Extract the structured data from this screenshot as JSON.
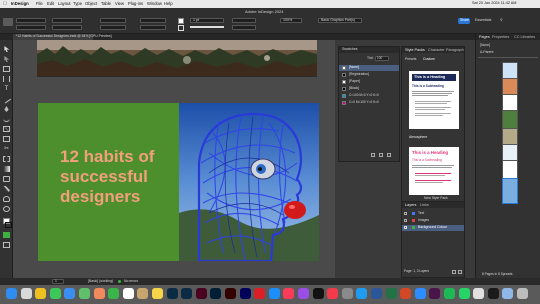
{
  "menubar": {
    "app": "InDesign",
    "items": [
      "File",
      "Edit",
      "Layout",
      "Type",
      "Object",
      "Table",
      "View",
      "Plug-ins",
      "Window",
      "Help"
    ],
    "title": "Adobe InDesign 2024",
    "clock": "Sat 20 Jan 2024 11:42 AM"
  },
  "controlbar": {
    "font_name": "Basic Graphics Part(s)",
    "share_label": "Share",
    "essentials_label": "Essentials",
    "stroke_value": "1 pt",
    "zoom_value": "100%"
  },
  "document": {
    "tab_label": "*12 Habits of Successful Designers.indd @ 54% [GPU Preview]"
  },
  "canvas": {
    "headline_line1": "12 habits of",
    "headline_line2": "successful",
    "headline_line3": "designers",
    "green": "#4c8f2c",
    "headline_color": "#f2a07c"
  },
  "swatches": {
    "title": "Swatches",
    "tint_label": "Tint:",
    "tint_value": "100",
    "items": [
      {
        "name": "[None]",
        "color": "#ffffff"
      },
      {
        "name": "[Registration]",
        "color": "#000000"
      },
      {
        "name": "[Paper]",
        "color": "#ffffff"
      },
      {
        "name": "[Black]",
        "color": "#000000"
      },
      {
        "name": "C=100 M=0 Y=0 K=0",
        "color": "#00a0e0"
      },
      {
        "name": "C=0 M=100 Y=0 K=0",
        "color": "#e0007a"
      }
    ]
  },
  "styles_panel": {
    "tabs": [
      "Style Packs",
      "Character",
      "Paragraph"
    ],
    "filters": [
      "Presets",
      "Custom"
    ],
    "preview1_heading": "This is a Heading",
    "preview1_subheading": "This is a Subheading",
    "section_label": "Atmosphere",
    "preview2_heading": "This is a Heading",
    "preview2_subheading": "This is a Subheading",
    "new_style_label": "New Style Pack"
  },
  "layers": {
    "tabs": [
      "Layers",
      "Links"
    ],
    "items": [
      {
        "name": "Text",
        "color": "#3c7bff"
      },
      {
        "name": "Images",
        "color": "#e04040"
      },
      {
        "name": "Background Colour",
        "color": "#3cb043"
      }
    ],
    "footer": "Page: 1, 3 Layers"
  },
  "pages": {
    "tabs": [
      "Pages",
      "Properties",
      "CC Libraries"
    ],
    "none_label": "[None]",
    "master_label": "A-Parent",
    "footer": "8 Pages in 8 Spreads"
  },
  "statusbar": {
    "page_value": "1",
    "style_label": "[Basic] (working)",
    "errors_label": "No errors"
  },
  "dock": {
    "apps": [
      {
        "name": "finder-icon",
        "color": "#2f8cf0"
      },
      {
        "name": "launchpad-icon",
        "color": "#d9d9d9"
      },
      {
        "name": "chrome-icon",
        "color": "#f0c020"
      },
      {
        "name": "messages-icon",
        "color": "#3cc85a"
      },
      {
        "name": "mail-icon",
        "color": "#3a8ef0"
      },
      {
        "name": "maps-icon",
        "color": "#5fbf6a"
      },
      {
        "name": "photos-icon",
        "color": "#f08a5d"
      },
      {
        "name": "facetime-icon",
        "color": "#3bb54a"
      },
      {
        "name": "calendar-icon",
        "color": "#ffffff"
      },
      {
        "name": "contacts-icon",
        "color": "#c8a46e"
      },
      {
        "name": "notes-icon",
        "color": "#f7d54a"
      },
      {
        "name": "lightroom-icon",
        "color": "#0b2a44"
      },
      {
        "name": "lightroom-classic-icon",
        "color": "#0b2a44"
      },
      {
        "name": "indesign-icon",
        "color": "#49021f"
      },
      {
        "name": "photoshop-icon",
        "color": "#001e36"
      },
      {
        "name": "illustrator-icon",
        "color": "#330000"
      },
      {
        "name": "premiere-icon",
        "color": "#00005b"
      },
      {
        "name": "creative-cloud-icon",
        "color": "#da1f26"
      },
      {
        "name": "app-store-icon",
        "color": "#1c8ef9"
      },
      {
        "name": "music-icon",
        "color": "#fa3c5a"
      },
      {
        "name": "podcasts-icon",
        "color": "#9a4ee5"
      },
      {
        "name": "tv-icon",
        "color": "#111111"
      },
      {
        "name": "news-icon",
        "color": "#f23a4a"
      },
      {
        "name": "settings-icon",
        "color": "#8a8a8a"
      },
      {
        "name": "safari-icon",
        "color": "#1f9cf0"
      },
      {
        "name": "word-icon",
        "color": "#2b579a"
      },
      {
        "name": "excel-icon",
        "color": "#217346"
      },
      {
        "name": "powerpoint-icon",
        "color": "#d24726"
      },
      {
        "name": "zoom-icon",
        "color": "#2d8cff"
      },
      {
        "name": "slack-icon",
        "color": "#4a154b"
      },
      {
        "name": "spotify-icon",
        "color": "#1db954"
      },
      {
        "name": "whatsapp-icon",
        "color": "#25d366"
      },
      {
        "name": "preview-icon",
        "color": "#e0e0e0"
      },
      {
        "name": "terminal-icon",
        "color": "#1a1a1a"
      },
      {
        "name": "downloads-icon",
        "color": "#8fb8e8"
      },
      {
        "name": "trash-icon",
        "color": "#bdbdbd"
      }
    ]
  }
}
